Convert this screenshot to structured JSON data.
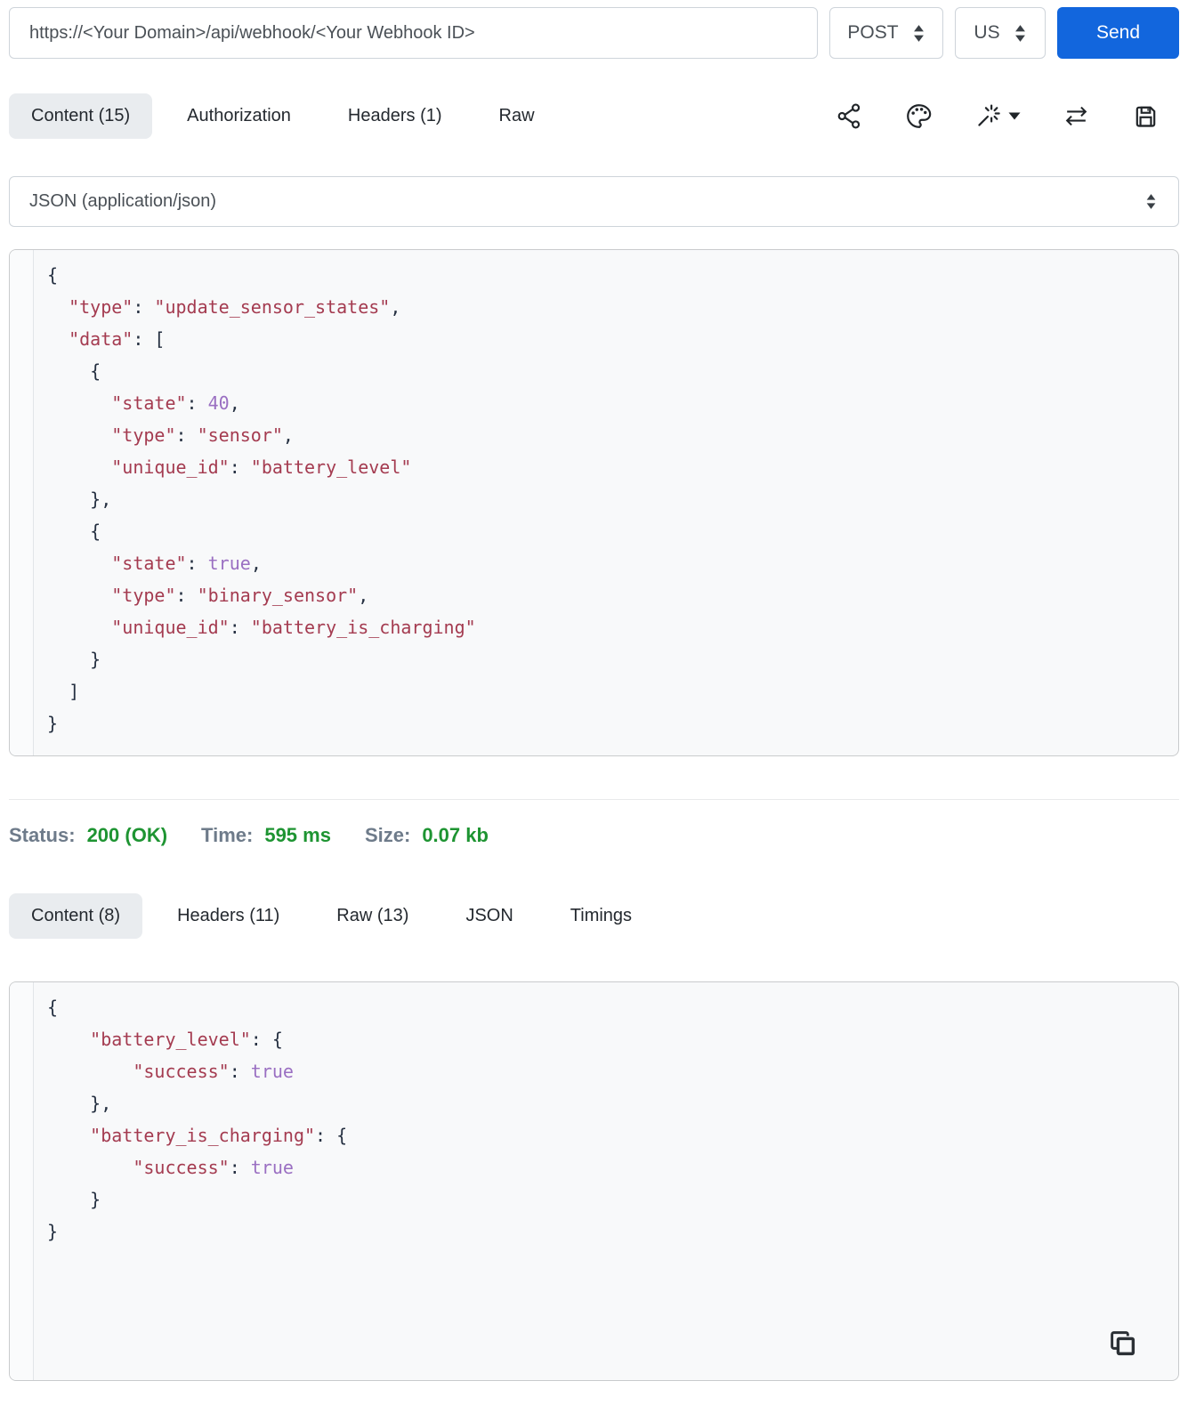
{
  "colors": {
    "accent_blue": "#1266dd",
    "json_string": "#a43b50",
    "json_literal": "#9a6fc2",
    "status_green": "#1e9432",
    "status_label_gray": "#6e7b8a",
    "active_tab_bg": "#e9ecef",
    "panel_bg": "#f8f9fa"
  },
  "request_bar": {
    "url": "https://<Your Domain>/api/webhook/<Your Webhook ID>",
    "method": "POST",
    "region": "US",
    "send_label": "Send"
  },
  "request_tabs": [
    {
      "label": "Content (15)",
      "active": true
    },
    {
      "label": "Authorization",
      "active": false
    },
    {
      "label": "Headers (1)",
      "active": false
    },
    {
      "label": "Raw",
      "active": false
    }
  ],
  "toolbar": {
    "icons": [
      "share-icon",
      "palette-icon",
      "magic-wand-icon",
      "swap-icon",
      "save-icon"
    ]
  },
  "body_type": {
    "selected": "JSON (application/json)"
  },
  "request_body": {
    "lines": [
      [
        [
          "p",
          "{"
        ]
      ],
      [
        [
          "k",
          "  \"type\""
        ],
        [
          "p",
          ": "
        ],
        [
          "s",
          "\"update_sensor_states\""
        ],
        [
          "p",
          ","
        ]
      ],
      [
        [
          "k",
          "  \"data\""
        ],
        [
          "p",
          ": ["
        ]
      ],
      [
        [
          "p",
          "    {"
        ]
      ],
      [
        [
          "k",
          "      \"state\""
        ],
        [
          "p",
          ": "
        ],
        [
          "n",
          "40"
        ],
        [
          "p",
          ","
        ]
      ],
      [
        [
          "k",
          "      \"type\""
        ],
        [
          "p",
          ": "
        ],
        [
          "s",
          "\"sensor\""
        ],
        [
          "p",
          ","
        ]
      ],
      [
        [
          "k",
          "      \"unique_id\""
        ],
        [
          "p",
          ": "
        ],
        [
          "s",
          "\"battery_level\""
        ]
      ],
      [
        [
          "p",
          "    },"
        ]
      ],
      [
        [
          "p",
          "    {"
        ]
      ],
      [
        [
          "k",
          "      \"state\""
        ],
        [
          "p",
          ": "
        ],
        [
          "n",
          "true"
        ],
        [
          "p",
          ","
        ]
      ],
      [
        [
          "k",
          "      \"type\""
        ],
        [
          "p",
          ": "
        ],
        [
          "s",
          "\"binary_sensor\""
        ],
        [
          "p",
          ","
        ]
      ],
      [
        [
          "k",
          "      \"unique_id\""
        ],
        [
          "p",
          ": "
        ],
        [
          "s",
          "\"battery_is_charging\""
        ]
      ],
      [
        [
          "p",
          "    }"
        ]
      ],
      [
        [
          "p",
          "  ]"
        ]
      ],
      [
        [
          "p",
          "}"
        ]
      ]
    ]
  },
  "status_bar": {
    "items": [
      {
        "label": "Status:",
        "value": "200 (OK)"
      },
      {
        "label": "Time:",
        "value": "595 ms"
      },
      {
        "label": "Size:",
        "value": "0.07 kb"
      }
    ]
  },
  "response_tabs": [
    {
      "label": "Content (8)",
      "active": true
    },
    {
      "label": "Headers (11)",
      "active": false
    },
    {
      "label": "Raw (13)",
      "active": false
    },
    {
      "label": "JSON",
      "active": false
    },
    {
      "label": "Timings",
      "active": false
    }
  ],
  "response_body": {
    "lines": [
      [
        [
          "p",
          "{"
        ]
      ],
      [
        [
          "k",
          "    \"battery_level\""
        ],
        [
          "p",
          ": {"
        ]
      ],
      [
        [
          "k",
          "        \"success\""
        ],
        [
          "p",
          ": "
        ],
        [
          "n",
          "true"
        ]
      ],
      [
        [
          "p",
          "    },"
        ]
      ],
      [
        [
          "k",
          "    \"battery_is_charging\""
        ],
        [
          "p",
          ": {"
        ]
      ],
      [
        [
          "k",
          "        \"success\""
        ],
        [
          "p",
          ": "
        ],
        [
          "n",
          "true"
        ]
      ],
      [
        [
          "p",
          "    }"
        ]
      ],
      [
        [
          "p",
          "}"
        ]
      ]
    ]
  }
}
